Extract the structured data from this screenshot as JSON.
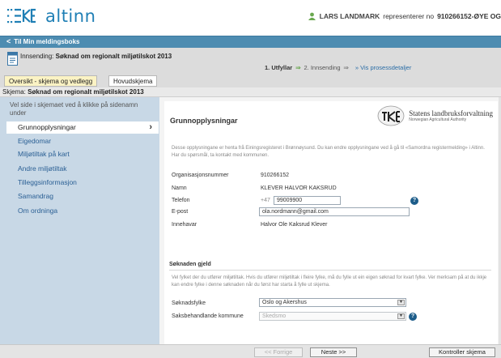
{
  "header": {
    "logo_text": "altinn",
    "user_name": "LARS LANDMARK",
    "represents_text": "representerer no",
    "org_text": "910266152-ØYE OG"
  },
  "nav": {
    "back_label": "Til Min meldingsboks"
  },
  "submission": {
    "prefix": "Innsending:",
    "title": "Søknad om regionalt miljøtilskot 2013",
    "steps": {
      "step1": "1. Utfyllar",
      "step2": "2. Innsending",
      "process_link": "Vis prosessdetaljer"
    }
  },
  "tabs": [
    {
      "label": "Oversikt - skjema og vedlegg"
    },
    {
      "label": "Hovudskjema"
    }
  ],
  "schema_bar": {
    "prefix": "Skjema:",
    "title": "Søknad om regionalt miljøtilskot 2013"
  },
  "sidebar": {
    "hint": "Vel side i skjemaet ved å klikke på sidenamn under",
    "items": [
      {
        "label": "Grunnopplysningar",
        "active": true
      },
      {
        "label": "Eigedomar"
      },
      {
        "label": "Miljøtiltak på kart"
      },
      {
        "label": "Andre miljøtiltak"
      },
      {
        "label": "Tilleggsinformasjon"
      },
      {
        "label": "Samandrag"
      },
      {
        "label": "Om ordninga"
      }
    ]
  },
  "main": {
    "section_title": "Grunnopplysningar",
    "agency_name": "Statens landbruksforvaltning",
    "agency_name_en": "Norwegian Agricultural Authority",
    "info_text": "Desse opplysningane er henta frå Einingsregisteret i Brønnøysund. Du kan endre opplysningane ved å gå til «Samordna registermelding» i Altinn. Har du spørsmål, ta kontakt med kommunen.",
    "fields": {
      "orgnr_label": "Organisasjonsnummer",
      "orgnr_value": "910266152",
      "namn_label": "Namn",
      "namn_value": "KLEVER HALVOR KAKSRUD",
      "telefon_label": "Telefon",
      "telefon_prefix": "+47",
      "telefon_value": "99009900",
      "epost_label": "E-post",
      "epost_value": "ola.nordmann@gmail.com",
      "innehavar_label": "Innehavar",
      "innehavar_value": "Halvor Ole Kaksrud Klever"
    },
    "soknad": {
      "title": "Søknaden gjeld",
      "note": "Vel fylket der du utfører miljøtiltak. Hvis du utfører miljøtiltak i fleire fylke, må du fylle ut ein eigen søknad for kvart fylke. Ver merksam på at du ikkje kan endre fylke i denne søknaden når du først har starta å fylle ut skjema.",
      "fylke_label": "Søknadsfylke",
      "fylke_value": "Oslo og Akershus",
      "kommune_label": "Saksbehandlande kommune",
      "kommune_value": "Skedsmo"
    }
  },
  "footer": {
    "prev_label": "<< Forrige",
    "next_label": "Neste >>",
    "check_label": "Kontroller skjema"
  }
}
